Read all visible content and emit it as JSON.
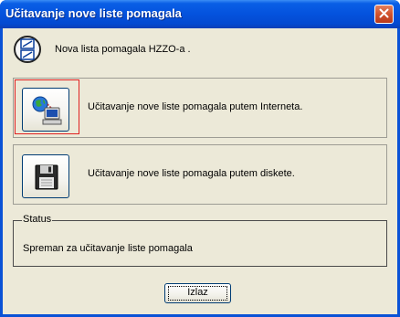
{
  "window": {
    "title": "Učitavanje nove liste pomagala"
  },
  "header": {
    "text": "Nova lista pomagala HZZO-a ."
  },
  "options": {
    "internet_label": "Učitavanje nove liste pomagala putem Interneta.",
    "disk_label": "Učitavanje nove liste pomagala putem diskete."
  },
  "status": {
    "legend": "Status",
    "text": "Spreman za učitavanje liste pomagala"
  },
  "footer": {
    "exit_label": "Izlaz"
  },
  "icons": {
    "close": "close-icon",
    "header": "document-exchange-icon",
    "internet": "globe-computer-icon",
    "disk": "floppy-disk-icon"
  },
  "colors": {
    "titlebar": "#0452dd",
    "client_bg": "#ece9d8",
    "close_button": "#d1532d",
    "focus_ring": "#e02020"
  }
}
